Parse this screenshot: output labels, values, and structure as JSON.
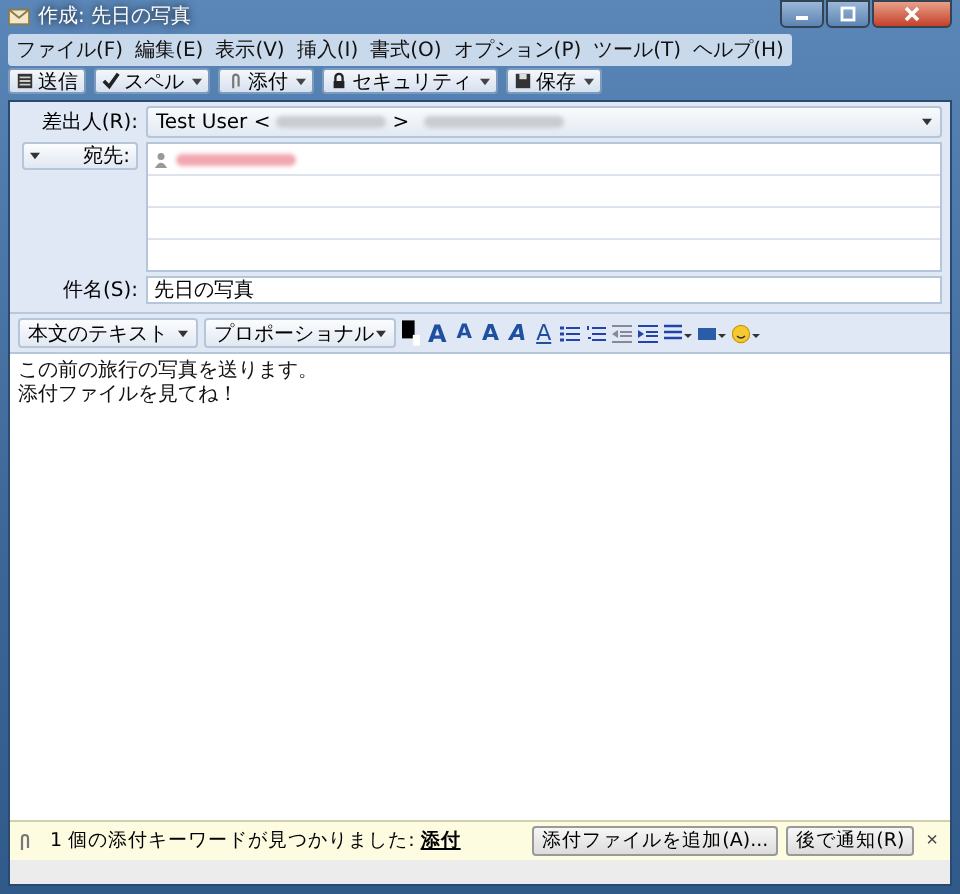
{
  "window": {
    "title": "作成: 先日の写真"
  },
  "menu": [
    "ファイル(F)",
    "編集(E)",
    "表示(V)",
    "挿入(I)",
    "書式(O)",
    "オプション(P)",
    "ツール(T)",
    "ヘルプ(H)"
  ],
  "toolbar": [
    {
      "label": "送信",
      "kind": "send",
      "dropdown": false
    },
    {
      "label": "スペル",
      "kind": "spell",
      "dropdown": true
    },
    {
      "label": "添付",
      "kind": "attach",
      "dropdown": true
    },
    {
      "label": "セキュリティ",
      "kind": "security",
      "dropdown": true
    },
    {
      "label": "保存",
      "kind": "save",
      "dropdown": true
    }
  ],
  "from": {
    "label": "差出人(R):",
    "name": "Test User <",
    "close": ">"
  },
  "to": {
    "label": "宛先:"
  },
  "subject": {
    "label": "件名(S):",
    "value": "先日の写真"
  },
  "format": {
    "style": "本文のテキスト",
    "font": "プロポーショナル",
    "letters": [
      {
        "text": "A",
        "kind": "grow"
      },
      {
        "text": "A",
        "kind": "shrink"
      },
      {
        "text": "A",
        "kind": "bold"
      },
      {
        "text": "A",
        "kind": "italic"
      },
      {
        "text": "A",
        "kind": "underline"
      }
    ]
  },
  "body": [
    "この前の旅行の写真を送ります。",
    "添付ファイルを見てね！"
  ],
  "notification": {
    "message": "1 個の添付キーワードが見つかりました: ",
    "keyword": "添付",
    "buttons": [
      "添付ファイルを追加(A)...",
      "後で通知(R)"
    ],
    "close": "×"
  }
}
